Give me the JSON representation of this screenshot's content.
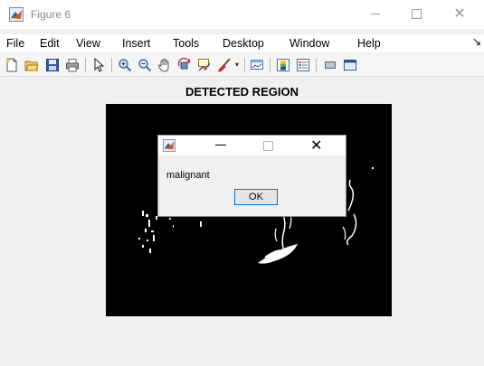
{
  "window": {
    "title": "Figure 6",
    "controls": {
      "minimize": "—",
      "maximize": "",
      "close": "✕"
    }
  },
  "menu": [
    "File",
    "Edit",
    "View",
    "Insert",
    "Tools",
    "Desktop",
    "Window",
    "Help"
  ],
  "toolbar": {
    "icons": [
      "new-figure-icon",
      "open-file-icon",
      "save-icon",
      "print-icon",
      "pointer-arrow-icon",
      "zoom-in-icon",
      "zoom-out-icon",
      "pan-hand-icon",
      "rotate-3d-icon",
      "data-cursor-icon",
      "brush-icon",
      "brush-dropdown-icon",
      "link-plot-icon",
      "colorbar-icon",
      "legend-icon",
      "hide-plot-tools-icon",
      "show-plot-tools-icon"
    ]
  },
  "figure": {
    "title": "DETECTED REGION"
  },
  "dialog": {
    "message": "malignant",
    "ok_label": "OK",
    "controls": {
      "minimize": "—",
      "close": "✕"
    }
  },
  "colors": {
    "matlab_orange": "#d95319",
    "matlab_blue": "#0072bd",
    "focus_border": "#0078d7"
  }
}
